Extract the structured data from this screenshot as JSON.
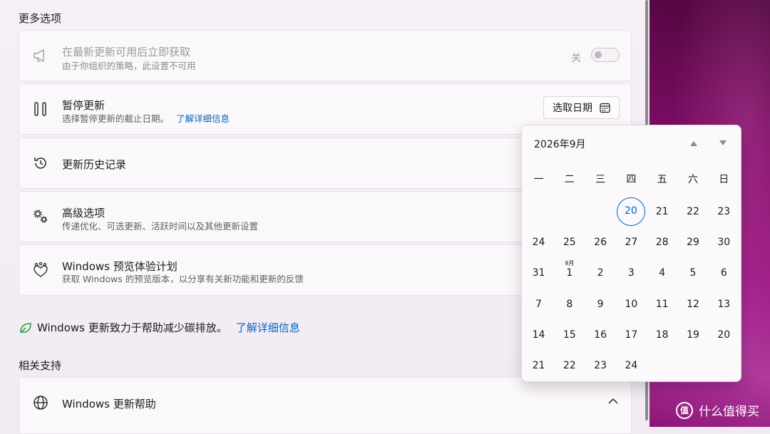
{
  "section_more": "更多选项",
  "instant": {
    "title": "在最新更新可用后立即获取",
    "desc": "由于你组织的策略，此设置不可用",
    "toggle_label": "关",
    "icon": "megaphone-icon"
  },
  "pause": {
    "title": "暂停更新",
    "desc": "选择暂停更新的截止日期。",
    "link": "了解详细信息",
    "button": "选取日期",
    "icon": "pause-icon"
  },
  "history": {
    "title": "更新历史记录",
    "icon": "history-icon"
  },
  "advanced": {
    "title": "高级选项",
    "desc": "传递优化、可选更新、活跃时间以及其他更新设置",
    "icon": "gears-icon"
  },
  "insider": {
    "title": "Windows 预览体验计划",
    "desc": "获取 Windows 的预览版本，以分享有关新功能和更新的反馈",
    "icon": "hearts-icon"
  },
  "carbon": {
    "text": "Windows 更新致力于帮助减少碳排放。",
    "link": "了解详细信息"
  },
  "section_support": "相关支持",
  "help": {
    "title": "Windows 更新帮助",
    "icon": "globe-icon"
  },
  "calendar": {
    "header": "2026年9月",
    "weekdays": [
      "一",
      "二",
      "三",
      "四",
      "五",
      "六",
      "日"
    ],
    "today": "20",
    "month_tag": "9月",
    "rows": [
      [
        "",
        "",
        "",
        "20",
        "21",
        "22",
        "23"
      ],
      [
        "24",
        "25",
        "26",
        "27",
        "28",
        "29",
        "30"
      ],
      [
        "31",
        "1",
        "2",
        "3",
        "4",
        "5",
        "6"
      ],
      [
        "7",
        "8",
        "9",
        "10",
        "11",
        "12",
        "13"
      ],
      [
        "14",
        "15",
        "16",
        "17",
        "18",
        "19",
        "20"
      ],
      [
        "21",
        "22",
        "23",
        "24",
        "",
        "",
        ""
      ]
    ]
  },
  "watermark": "什么值得买",
  "colors": {
    "accent": "#0067c0",
    "wallpaper": "#7a0c63"
  }
}
